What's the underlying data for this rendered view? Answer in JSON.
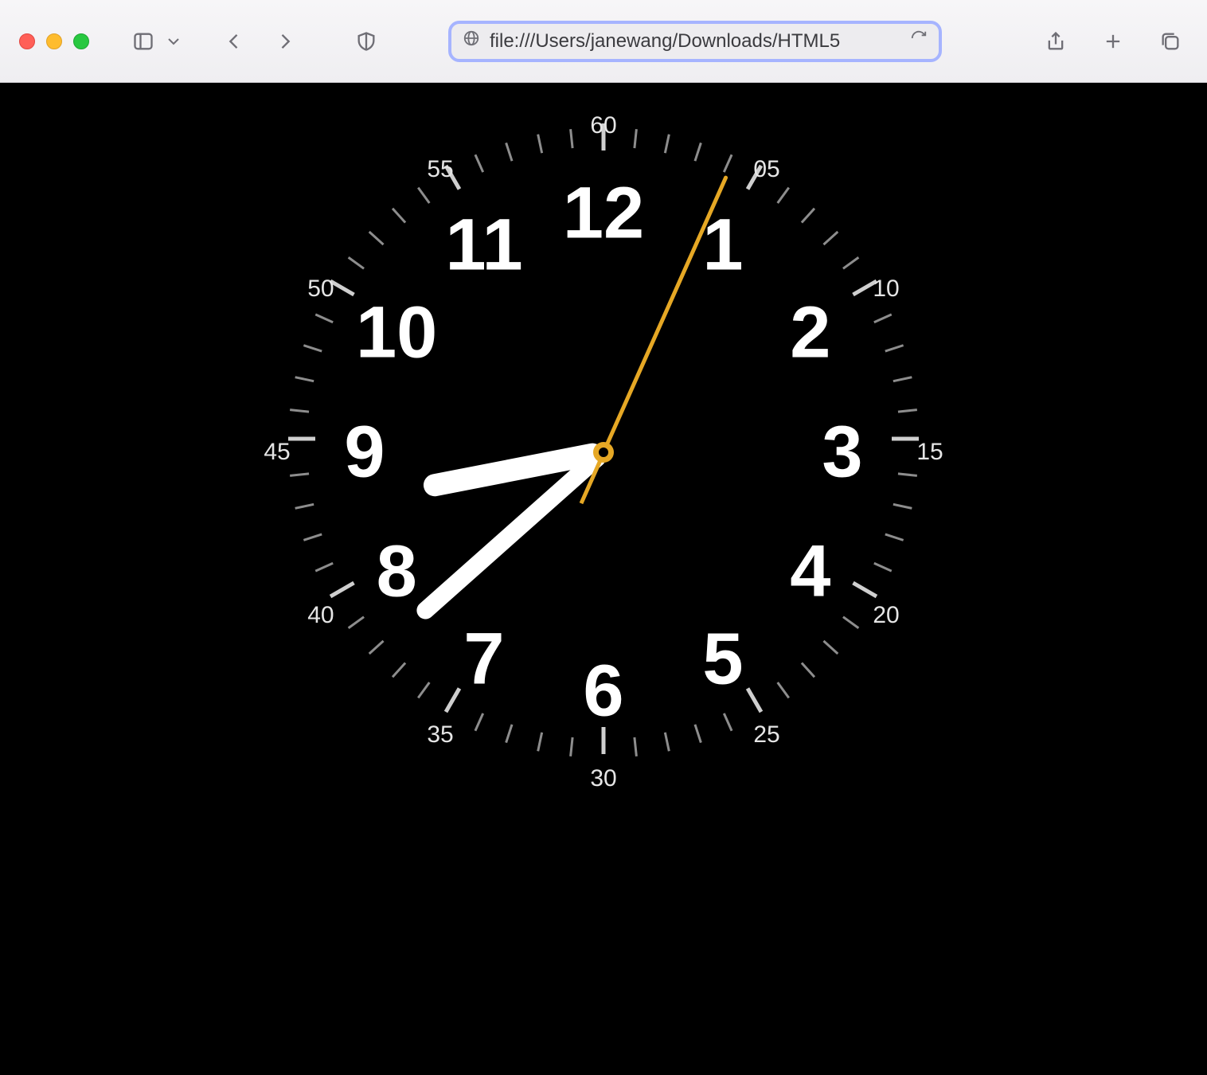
{
  "browser": {
    "url": "file:///Users/janewang/Downloads/HTML5",
    "traffic_colors": {
      "close": "#ff5f57",
      "min": "#febc2e",
      "max": "#28c840"
    }
  },
  "clock": {
    "hour_numerals": [
      "12",
      "1",
      "2",
      "3",
      "4",
      "5",
      "6",
      "7",
      "8",
      "9",
      "10",
      "11"
    ],
    "second_numerals": [
      "60",
      "05",
      "10",
      "15",
      "20",
      "25",
      "30",
      "35",
      "40",
      "45",
      "50",
      "55"
    ],
    "time": {
      "hours": 8,
      "minutes": 38,
      "seconds": 4
    },
    "colors": {
      "face_bg": "#000",
      "numerals": "#fff",
      "ticks": "#8d8d8d",
      "second_hand": "#e6a825"
    }
  }
}
